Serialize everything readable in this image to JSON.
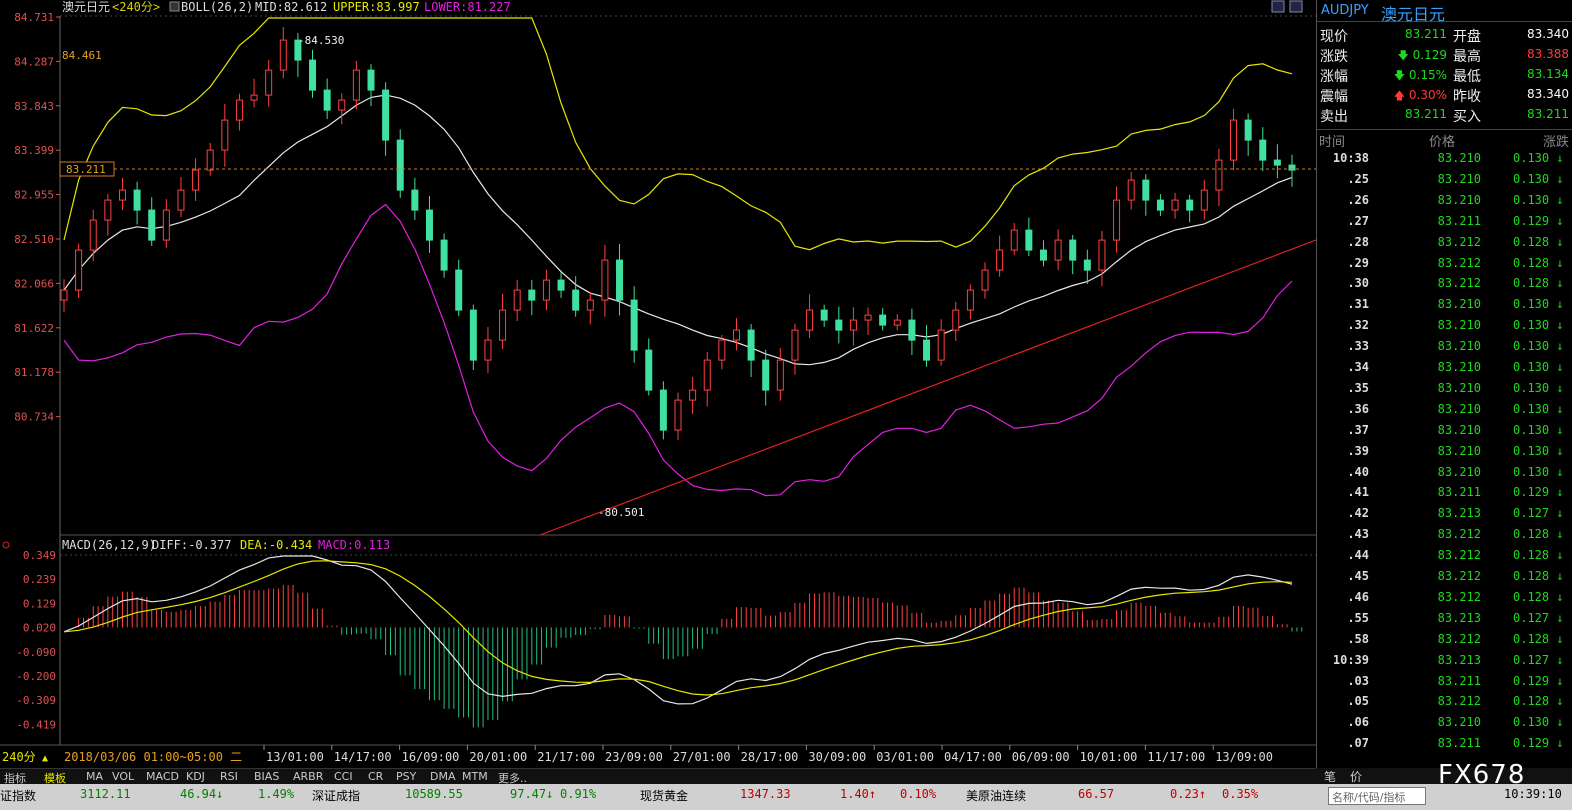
{
  "header": {
    "symbol_title": "澳元日元",
    "period": "<240分>",
    "boll_label": "BOLL(26,2)",
    "mid": "MID:82.612",
    "upper": "UPPER:83.997",
    "lower": "LOWER:81.227"
  },
  "price_axis": [
    "84.731",
    "84.287",
    "83.843",
    "83.399",
    "82.955",
    "82.510",
    "82.066",
    "81.622",
    "81.178",
    "80.734"
  ],
  "annotations": {
    "high": "84.530",
    "low": "80.501",
    "left_value": "84.461",
    "current": "83.211"
  },
  "macd_header": {
    "label": "MACD(26,12,9)",
    "diff": "DIFF:-0.377",
    "dea": "DEA:-0.434",
    "macd": "MACD:0.113"
  },
  "macd_axis": [
    "0.349",
    "0.239",
    "0.129",
    "0.020",
    "-0.090",
    "-0.200",
    "-0.309",
    "-0.419"
  ],
  "time_axis": {
    "period_button": "240分",
    "range_label": "2018/03/06 01:00~05:00 二",
    "labels": [
      "13/01:00",
      "14/17:00",
      "16/09:00",
      "20/01:00",
      "21/17:00",
      "23/09:00",
      "27/01:00",
      "28/17:00",
      "30/09:00",
      "03/01:00",
      "04/17:00",
      "06/09:00",
      "10/01:00",
      "11/17:00",
      "13/09:00"
    ]
  },
  "tabs": [
    "指标",
    "模板",
    "MA",
    "VOL",
    "MACD",
    "KDJ",
    "RSI",
    "BIAS",
    "ARBR",
    "CCI",
    "CR",
    "PSY",
    "DMA",
    "MTM",
    "更多.."
  ],
  "sidebar": {
    "symbol": "AUDJPY",
    "name": "澳元日元",
    "quotes": [
      {
        "l1": "现价",
        "v1": "83.211",
        "c1": "#1fd81f",
        "a1": "",
        "l2": "开盘",
        "v2": "83.340",
        "c2": "#ffffff"
      },
      {
        "l1": "涨跌",
        "v1": "0.129",
        "c1": "#1fd81f",
        "a1": "down",
        "l2": "最高",
        "v2": "83.388",
        "c2": "#ff3b3b"
      },
      {
        "l1": "涨幅",
        "v1": "0.15%",
        "c1": "#1fd81f",
        "a1": "down",
        "l2": "最低",
        "v2": "83.134",
        "c2": "#1fd81f"
      },
      {
        "l1": "震幅",
        "v1": "0.30%",
        "c1": "#ff3b3b",
        "a1": "up",
        "l2": "昨收",
        "v2": "83.340",
        "c2": "#ffffff"
      },
      {
        "l1": "卖出",
        "v1": "83.211",
        "c1": "#1fd81f",
        "a1": "",
        "l2": "买入",
        "v2": "83.211",
        "c2": "#1fd81f"
      }
    ],
    "tick_headers": [
      "时间",
      "价格",
      "涨跌"
    ],
    "ticks": [
      {
        "t": "10:38",
        "p": "83.210",
        "c": "0.130"
      },
      {
        "t": ".25",
        "p": "83.210",
        "c": "0.130"
      },
      {
        "t": ".26",
        "p": "83.210",
        "c": "0.130"
      },
      {
        "t": ".27",
        "p": "83.211",
        "c": "0.129"
      },
      {
        "t": ".28",
        "p": "83.212",
        "c": "0.128"
      },
      {
        "t": ".29",
        "p": "83.212",
        "c": "0.128"
      },
      {
        "t": ".30",
        "p": "83.212",
        "c": "0.128"
      },
      {
        "t": ".31",
        "p": "83.210",
        "c": "0.130"
      },
      {
        "t": ".32",
        "p": "83.210",
        "c": "0.130"
      },
      {
        "t": ".33",
        "p": "83.210",
        "c": "0.130"
      },
      {
        "t": ".34",
        "p": "83.210",
        "c": "0.130"
      },
      {
        "t": ".35",
        "p": "83.210",
        "c": "0.130"
      },
      {
        "t": ".36",
        "p": "83.210",
        "c": "0.130"
      },
      {
        "t": ".37",
        "p": "83.210",
        "c": "0.130"
      },
      {
        "t": ".39",
        "p": "83.210",
        "c": "0.130"
      },
      {
        "t": ".40",
        "p": "83.210",
        "c": "0.130"
      },
      {
        "t": ".41",
        "p": "83.211",
        "c": "0.129"
      },
      {
        "t": ".42",
        "p": "83.213",
        "c": "0.127"
      },
      {
        "t": ".43",
        "p": "83.212",
        "c": "0.128"
      },
      {
        "t": ".44",
        "p": "83.212",
        "c": "0.128"
      },
      {
        "t": ".45",
        "p": "83.212",
        "c": "0.128"
      },
      {
        "t": ".46",
        "p": "83.212",
        "c": "0.128"
      },
      {
        "t": ".55",
        "p": "83.213",
        "c": "0.127"
      },
      {
        "t": ".58",
        "p": "83.212",
        "c": "0.128"
      },
      {
        "t": "10:39",
        "p": "83.213",
        "c": "0.127"
      },
      {
        "t": ".03",
        "p": "83.211",
        "c": "0.129"
      },
      {
        "t": ".05",
        "p": "83.212",
        "c": "0.128"
      },
      {
        "t": ".06",
        "p": "83.210",
        "c": "0.130"
      },
      {
        "t": ".07",
        "p": "83.211",
        "c": "0.129"
      }
    ],
    "bottom_tabs": [
      "笔",
      "价"
    ]
  },
  "status_bar": {
    "items": [
      {
        "label": "证指数",
        "value": "3112.11",
        "change": "46.94",
        "arrow": "↓",
        "pct": "1.49%",
        "color": "#008000"
      },
      {
        "label": "深证成指",
        "value": "10589.55",
        "change": "97.47",
        "arrow": "↓",
        "pct": "0.91%",
        "color": "#008000"
      },
      {
        "label": "现货黄金",
        "value": "1347.33",
        "change": "1.40",
        "arrow": "↑",
        "pct": "0.10%",
        "color": "#c00000"
      },
      {
        "label": "美原油连续",
        "value": "66.57",
        "change": "0.23",
        "arrow": "↑",
        "pct": "0.35%",
        "color": "#c00000"
      }
    ],
    "search_placeholder": "名称/代码/指标",
    "clock": "10:39:10"
  },
  "watermark": "FX678",
  "chart_data": {
    "type": "candlestick",
    "title": "澳元日元 <240分>",
    "indicators": [
      "BOLL(26,2)",
      "MACD(26,12,9)"
    ],
    "ylim": [
      80.5,
      84.731
    ],
    "macd_ylim": [
      -0.419,
      0.349
    ],
    "key_points": {
      "swing_high": 84.53,
      "swing_low": 80.501,
      "current": 83.211
    },
    "boll": {
      "mid": 82.612,
      "upper": 83.997,
      "lower": 81.227
    },
    "macd": {
      "diff": -0.377,
      "dea": -0.434,
      "macd": 0.113
    },
    "close_path": [
      82.0,
      82.4,
      82.7,
      82.9,
      83.0,
      82.8,
      82.5,
      82.8,
      83.0,
      83.2,
      83.4,
      83.7,
      83.9,
      83.95,
      84.2,
      84.5,
      84.3,
      84.0,
      83.8,
      83.9,
      84.2,
      84.0,
      83.5,
      83.0,
      82.8,
      82.5,
      82.2,
      81.8,
      81.3,
      81.5,
      81.8,
      82.0,
      81.9,
      82.1,
      82.0,
      81.8,
      81.9,
      82.3,
      81.9,
      81.4,
      81.0,
      80.6,
      80.9,
      81.0,
      81.3,
      81.5,
      81.6,
      81.3,
      81.0,
      81.3,
      81.6,
      81.8,
      81.7,
      81.6,
      81.7,
      81.75,
      81.65,
      81.7,
      81.5,
      81.3,
      81.6,
      81.8,
      82.0,
      82.2,
      82.4,
      82.6,
      82.4,
      82.3,
      82.5,
      82.3,
      82.2,
      82.5,
      82.9,
      83.1,
      82.9,
      82.8,
      82.9,
      82.8,
      83.0,
      83.3,
      83.7,
      83.5,
      83.3,
      83.25,
      83.2
    ]
  }
}
